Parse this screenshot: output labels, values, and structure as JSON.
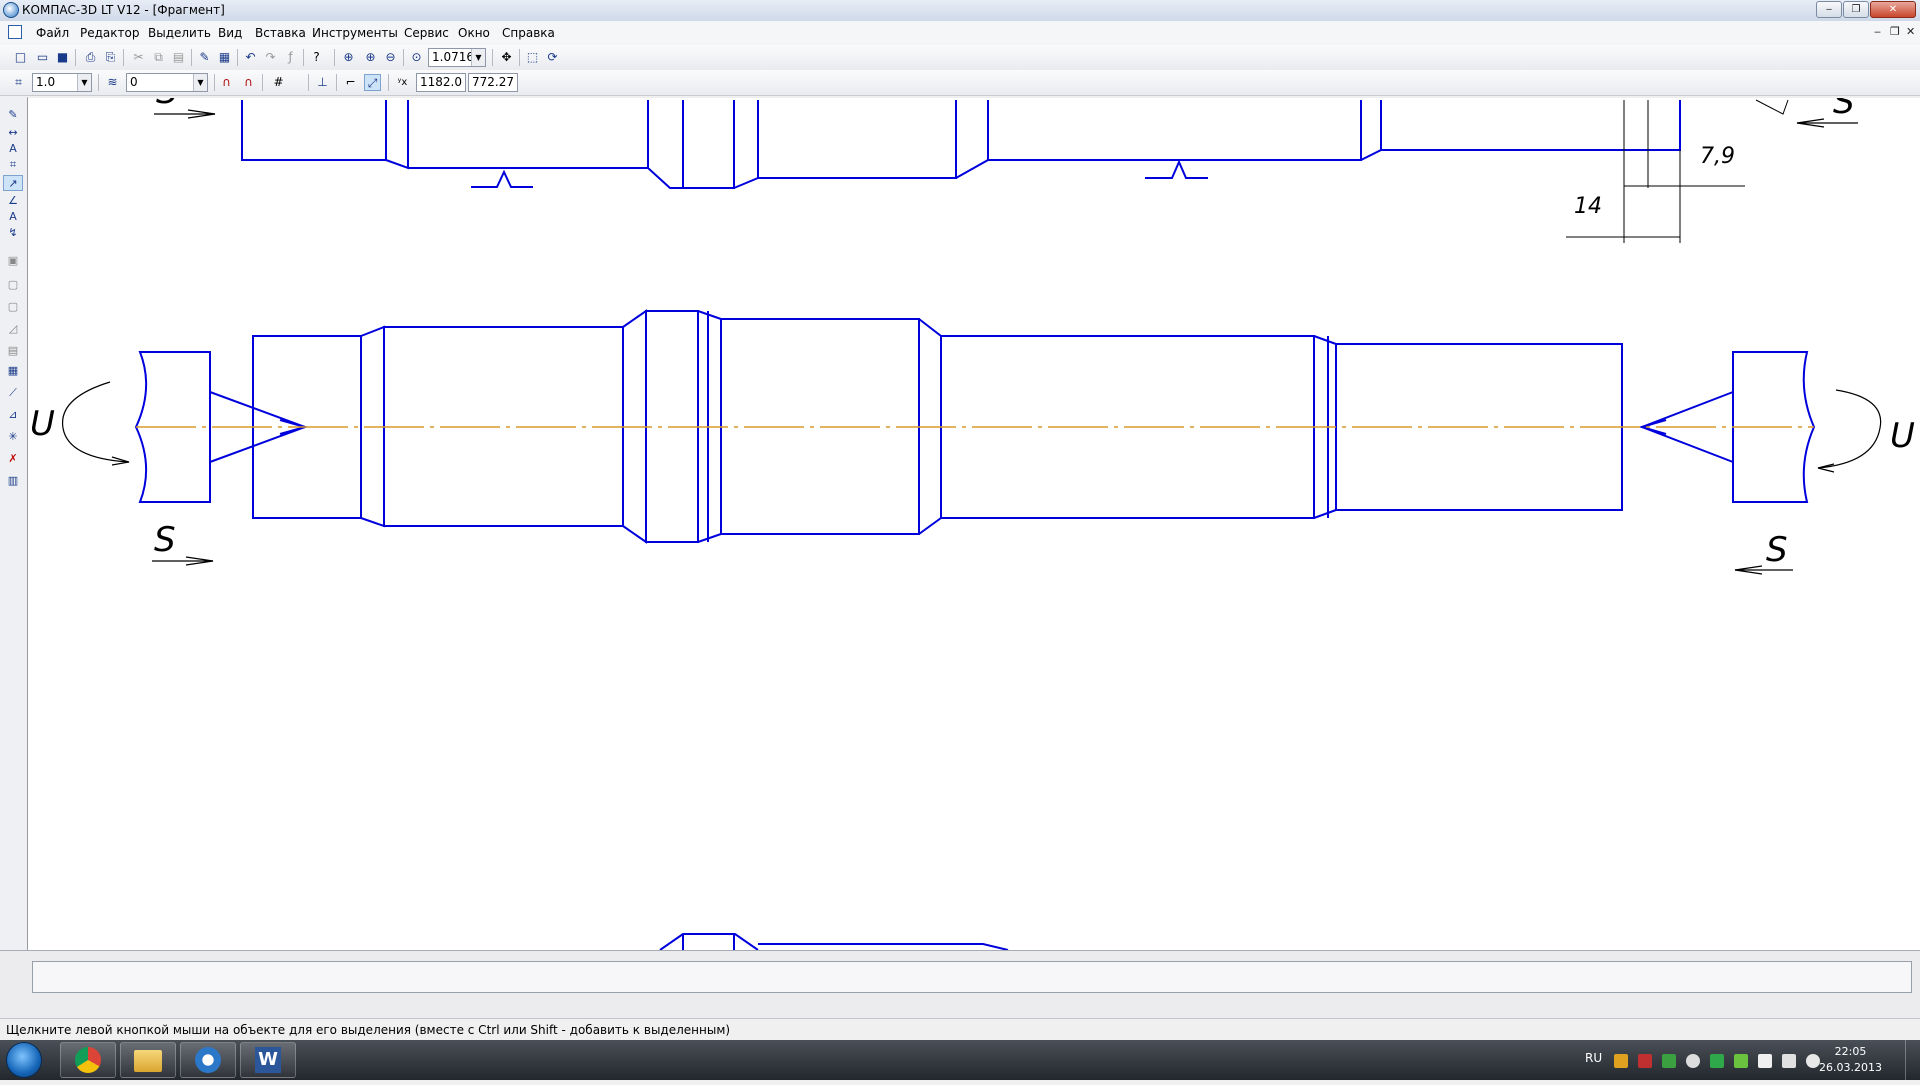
{
  "window": {
    "title": "КОМПАС-3D LT V12 - [Фрагмент]"
  },
  "menu": {
    "items": [
      "Файл",
      "Редактор",
      "Выделить",
      "Вид",
      "Вставка",
      "Инструменты",
      "Сервис",
      "Окно",
      "Справка"
    ]
  },
  "toolbar1": {
    "zoom_value": "1.0716"
  },
  "toolbar2": {
    "step_value": "1.0",
    "layer_value": "0",
    "coord_x": "1182.0",
    "coord_y": "772.27"
  },
  "drawing": {
    "labels": {
      "s": "S",
      "u": "U"
    },
    "dims": {
      "d1": "7,9",
      "d2": "14"
    },
    "colors": {
      "outline": "#0000dd",
      "axis": "#d89a2a",
      "dim": "#000000"
    }
  },
  "status": {
    "text": "Щелкните левой кнопкой мыши на объекте для его выделения (вместе с Ctrl или Shift - добавить к выделенным)"
  },
  "taskbar": {
    "lang": "RU",
    "time": "22:05",
    "date": "26.03.2013",
    "apps": [
      {
        "name": "chrome-icon"
      },
      {
        "name": "explorer-icon"
      },
      {
        "name": "kompas-icon"
      },
      {
        "name": "word-icon",
        "label": "W"
      }
    ]
  }
}
